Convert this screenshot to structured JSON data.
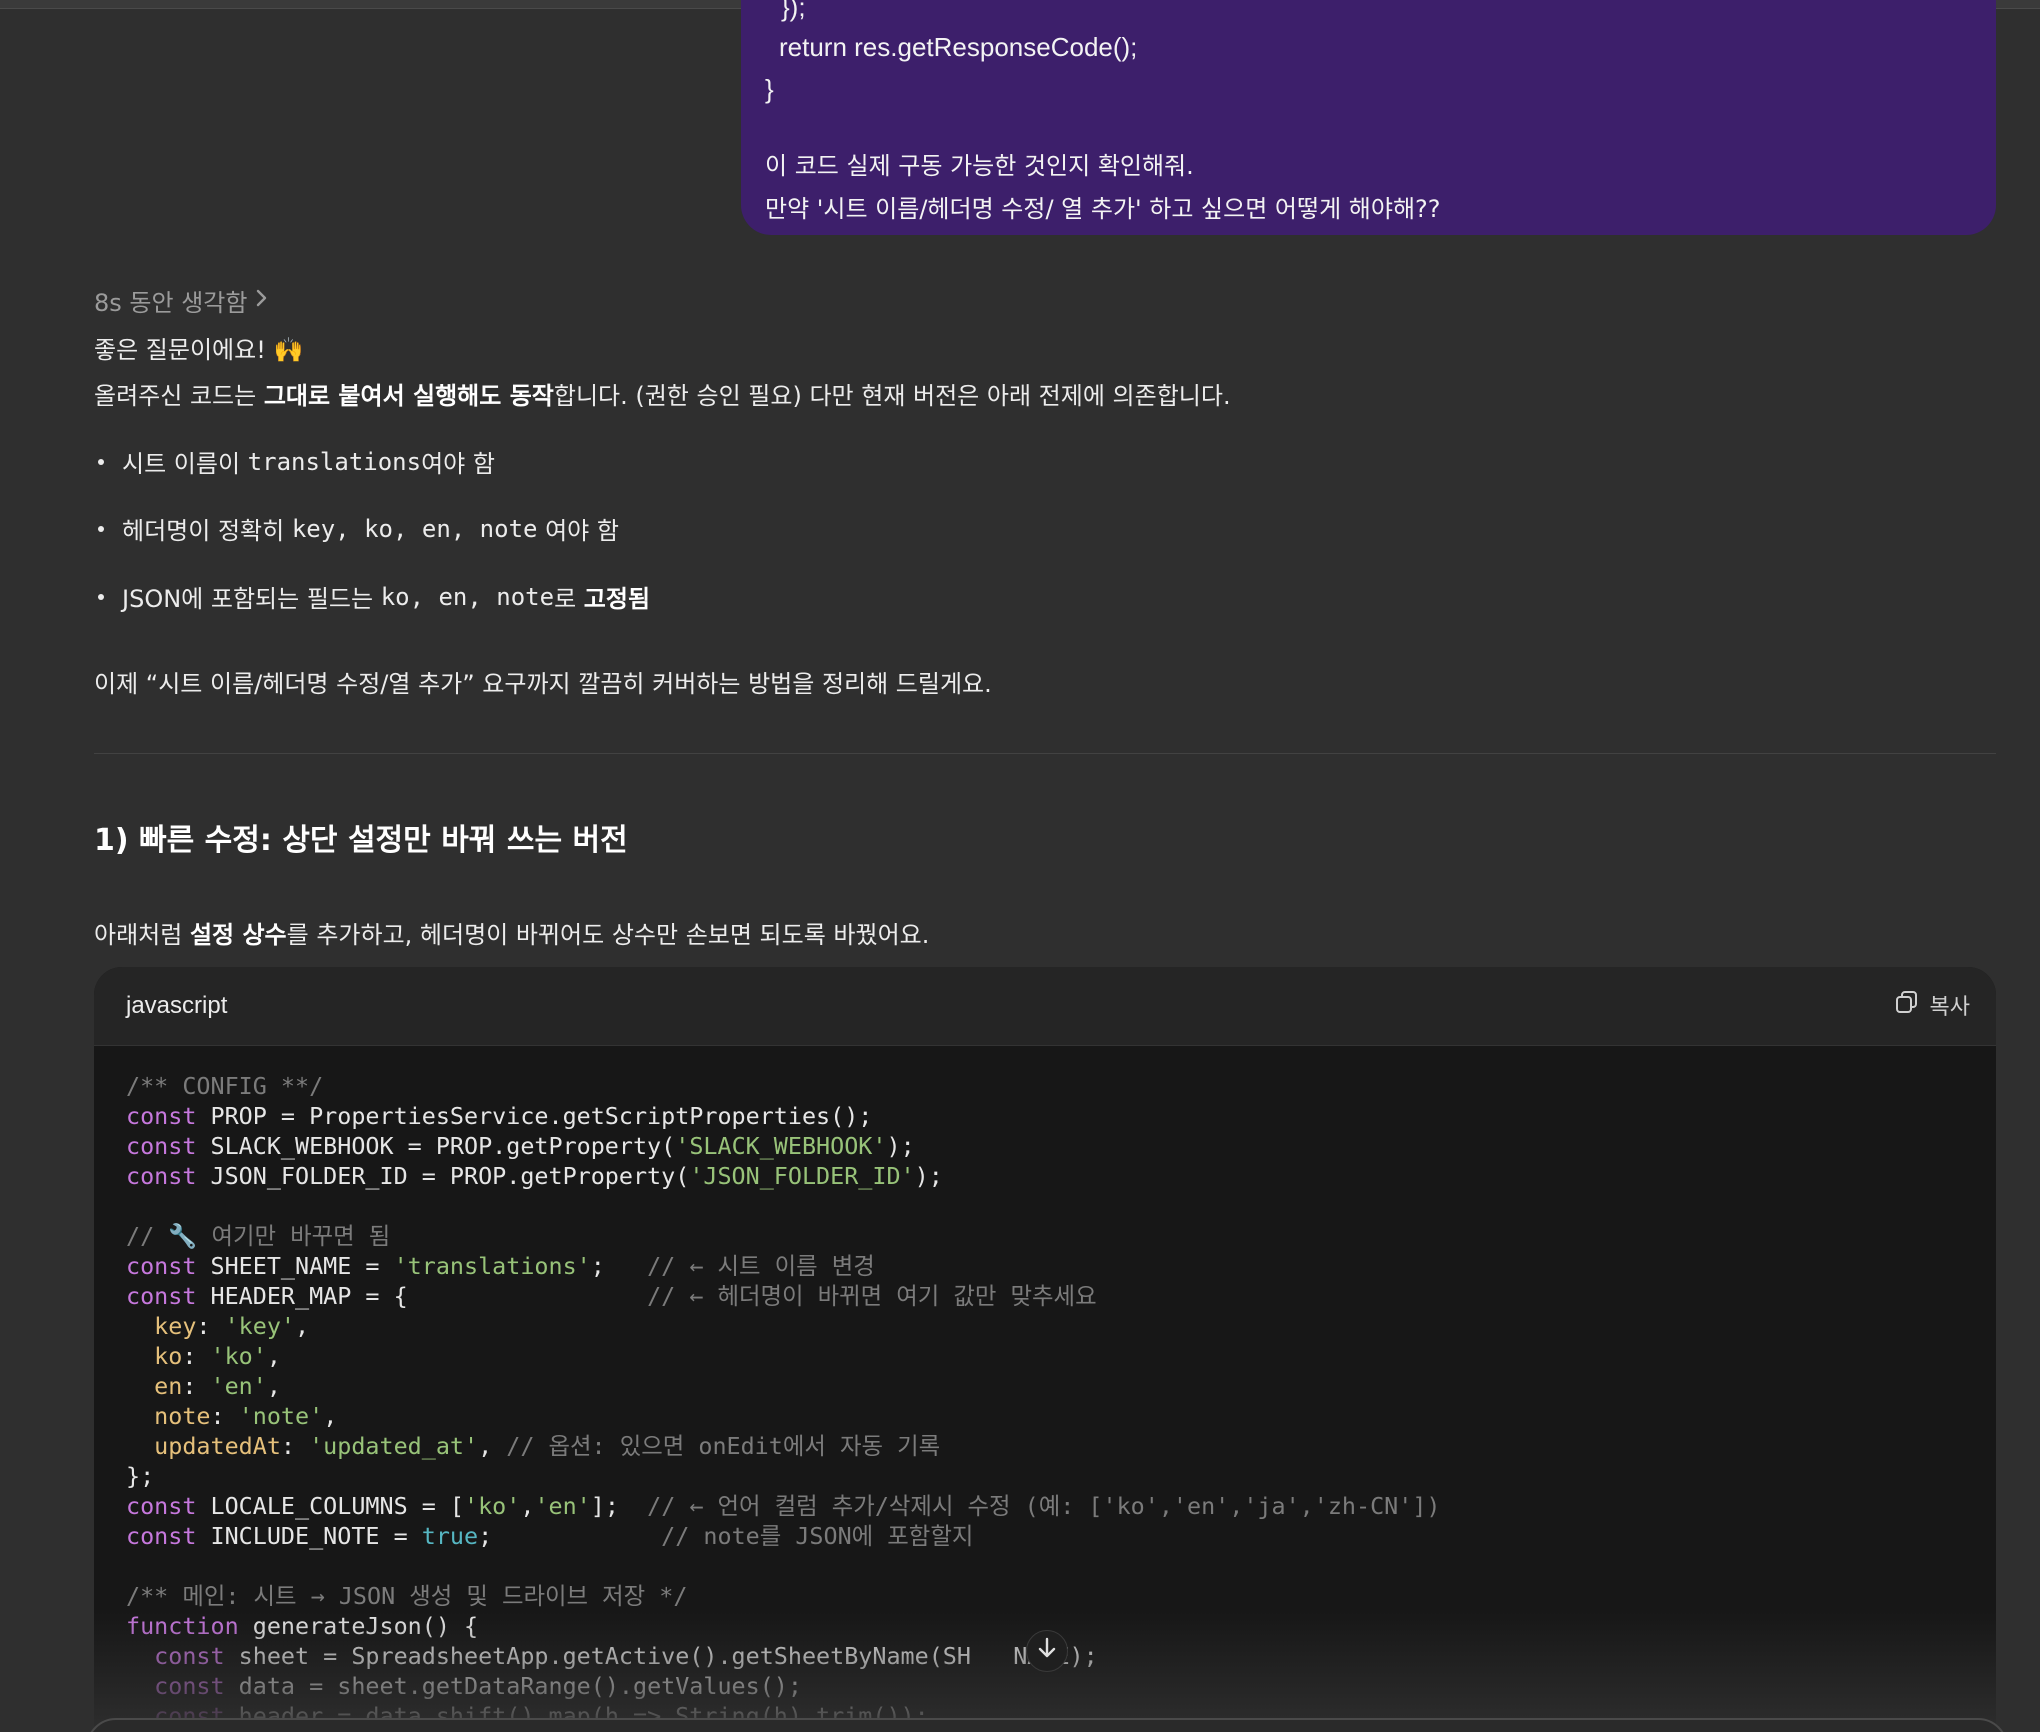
{
  "user_message": {
    "code_tail": [
      "});",
      "return res.getResponseCode();",
      "}"
    ],
    "lines": [
      "이 코드 실제 구동 가능한 것인지 확인해줘.",
      "만약 '시트 이름/헤더명 수정/ 열 추가' 하고 싶으면 어떻게 해야해??"
    ]
  },
  "assistant": {
    "thinking_label": "8s 동안 생각함",
    "intro": "좋은 질문이에요! 🙌",
    "p1_pre": "올려주신 코드는 ",
    "p1_bold": "그대로 붙여서 실행해도 동작",
    "p1_post": "합니다. (권한 승인 필요) 다만 현재 버전은 아래 전제에 의존합니다.",
    "bullets": [
      {
        "pre": "시트 이름이 ",
        "code": "translations",
        "post": "여야 함"
      },
      {
        "pre": "헤더명이 정확히 ",
        "code": "key, ko, en, note",
        "post": " 여야 함"
      },
      {
        "pre": "JSON에 포함되는 필드는 ",
        "code": "ko, en, note",
        "post": "로 ",
        "bold": "고정됨"
      }
    ],
    "p2": "이제 “시트 이름/헤더명 수정/열 추가” 요구까지 깔끔히 커버하는 방법을 정리해 드릴게요.",
    "heading": "1) 빠른 수정: 상단 설정만 바꿔 쓰는 버전",
    "p3_pre": "아래처럼 ",
    "p3_bold": "설정 상수",
    "p3_post": "를 추가하고, 헤더명이 바뀌어도 상수만 손보면 되도록 바꿨어요."
  },
  "codeblock": {
    "language": "javascript",
    "copy_label": "복사",
    "lines": [
      [
        {
          "t": "/** CONFIG **/",
          "c": "c"
        }
      ],
      [
        {
          "t": "const",
          "c": "k"
        },
        {
          "t": " PROP = PropertiesService.getScriptProperties();",
          "c": ""
        }
      ],
      [
        {
          "t": "const",
          "c": "k"
        },
        {
          "t": " SLACK_WEBHOOK = PROP.getProperty(",
          "c": ""
        },
        {
          "t": "'SLACK_WEBHOOK'",
          "c": "s"
        },
        {
          "t": ");",
          "c": ""
        }
      ],
      [
        {
          "t": "const",
          "c": "k"
        },
        {
          "t": " JSON_FOLDER_ID = PROP.getProperty(",
          "c": ""
        },
        {
          "t": "'JSON_FOLDER_ID'",
          "c": "s"
        },
        {
          "t": ");",
          "c": ""
        }
      ],
      [],
      [
        {
          "t": "// 🔧 여기만 바꾸면 됨",
          "c": "c"
        }
      ],
      [
        {
          "t": "const",
          "c": "k"
        },
        {
          "t": " SHEET_NAME = ",
          "c": ""
        },
        {
          "t": "'translations'",
          "c": "s"
        },
        {
          "t": ";   ",
          "c": ""
        },
        {
          "t": "// ← 시트 이름 변경",
          "c": "c"
        }
      ],
      [
        {
          "t": "const",
          "c": "k"
        },
        {
          "t": " HEADER_MAP = {                 ",
          "c": ""
        },
        {
          "t": "// ← 헤더명이 바뀌면 여기 값만 맞추세요",
          "c": "c"
        }
      ],
      [
        {
          "t": "  ",
          "c": ""
        },
        {
          "t": "key",
          "c": "p"
        },
        {
          "t": ": ",
          "c": ""
        },
        {
          "t": "'key'",
          "c": "s"
        },
        {
          "t": ",",
          "c": ""
        }
      ],
      [
        {
          "t": "  ",
          "c": ""
        },
        {
          "t": "ko",
          "c": "p"
        },
        {
          "t": ": ",
          "c": ""
        },
        {
          "t": "'ko'",
          "c": "s"
        },
        {
          "t": ",",
          "c": ""
        }
      ],
      [
        {
          "t": "  ",
          "c": ""
        },
        {
          "t": "en",
          "c": "p"
        },
        {
          "t": ": ",
          "c": ""
        },
        {
          "t": "'en'",
          "c": "s"
        },
        {
          "t": ",",
          "c": ""
        }
      ],
      [
        {
          "t": "  ",
          "c": ""
        },
        {
          "t": "note",
          "c": "p"
        },
        {
          "t": ": ",
          "c": ""
        },
        {
          "t": "'note'",
          "c": "s"
        },
        {
          "t": ",",
          "c": ""
        }
      ],
      [
        {
          "t": "  ",
          "c": ""
        },
        {
          "t": "updatedAt",
          "c": "p"
        },
        {
          "t": ": ",
          "c": ""
        },
        {
          "t": "'updated_at'",
          "c": "s"
        },
        {
          "t": ", ",
          "c": ""
        },
        {
          "t": "// 옵션: 있으면 onEdit에서 자동 기록",
          "c": "c"
        }
      ],
      [
        {
          "t": "};",
          "c": ""
        }
      ],
      [
        {
          "t": "const",
          "c": "k"
        },
        {
          "t": " LOCALE_COLUMNS = [",
          "c": ""
        },
        {
          "t": "'ko'",
          "c": "s"
        },
        {
          "t": ",",
          "c": ""
        },
        {
          "t": "'en'",
          "c": "s"
        },
        {
          "t": "];  ",
          "c": ""
        },
        {
          "t": "// ← 언어 컬럼 추가/삭제시 수정 (예: ['ko','en','ja','zh-CN'])",
          "c": "c"
        }
      ],
      [
        {
          "t": "const",
          "c": "k"
        },
        {
          "t": " INCLUDE_NOTE = ",
          "c": ""
        },
        {
          "t": "true",
          "c": "b"
        },
        {
          "t": ";            ",
          "c": ""
        },
        {
          "t": "// note를 JSON에 포함할지",
          "c": "c"
        }
      ],
      [],
      [
        {
          "t": "/** 메인: 시트 → JSON 생성 및 드라이브 저장 */",
          "c": "c"
        }
      ],
      [
        {
          "t": "function",
          "c": "k"
        },
        {
          "t": " generateJson() {",
          "c": ""
        }
      ],
      [
        {
          "t": "  ",
          "c": ""
        },
        {
          "t": "const",
          "c": "k"
        },
        {
          "t": " sheet = SpreadsheetApp.getActive().getSheetByName(SH",
          "c": ""
        },
        {
          "t": "   ",
          "c": ""
        },
        {
          "t": "NAME);",
          "c": ""
        }
      ],
      [
        {
          "t": "  ",
          "c": ""
        },
        {
          "t": "const",
          "c": "k"
        },
        {
          "t": " data = sheet.getDataRange().getValues();",
          "c": ""
        }
      ],
      [
        {
          "t": "  ",
          "c": ""
        },
        {
          "t": "const",
          "c": "k"
        },
        {
          "t": " header = data.shift().map(h => String(h).trim());",
          "c": ""
        }
      ]
    ]
  },
  "icons": {
    "copy": "copy-icon",
    "chevron": "chevron-right-icon",
    "scroll": "arrow-down-icon"
  }
}
